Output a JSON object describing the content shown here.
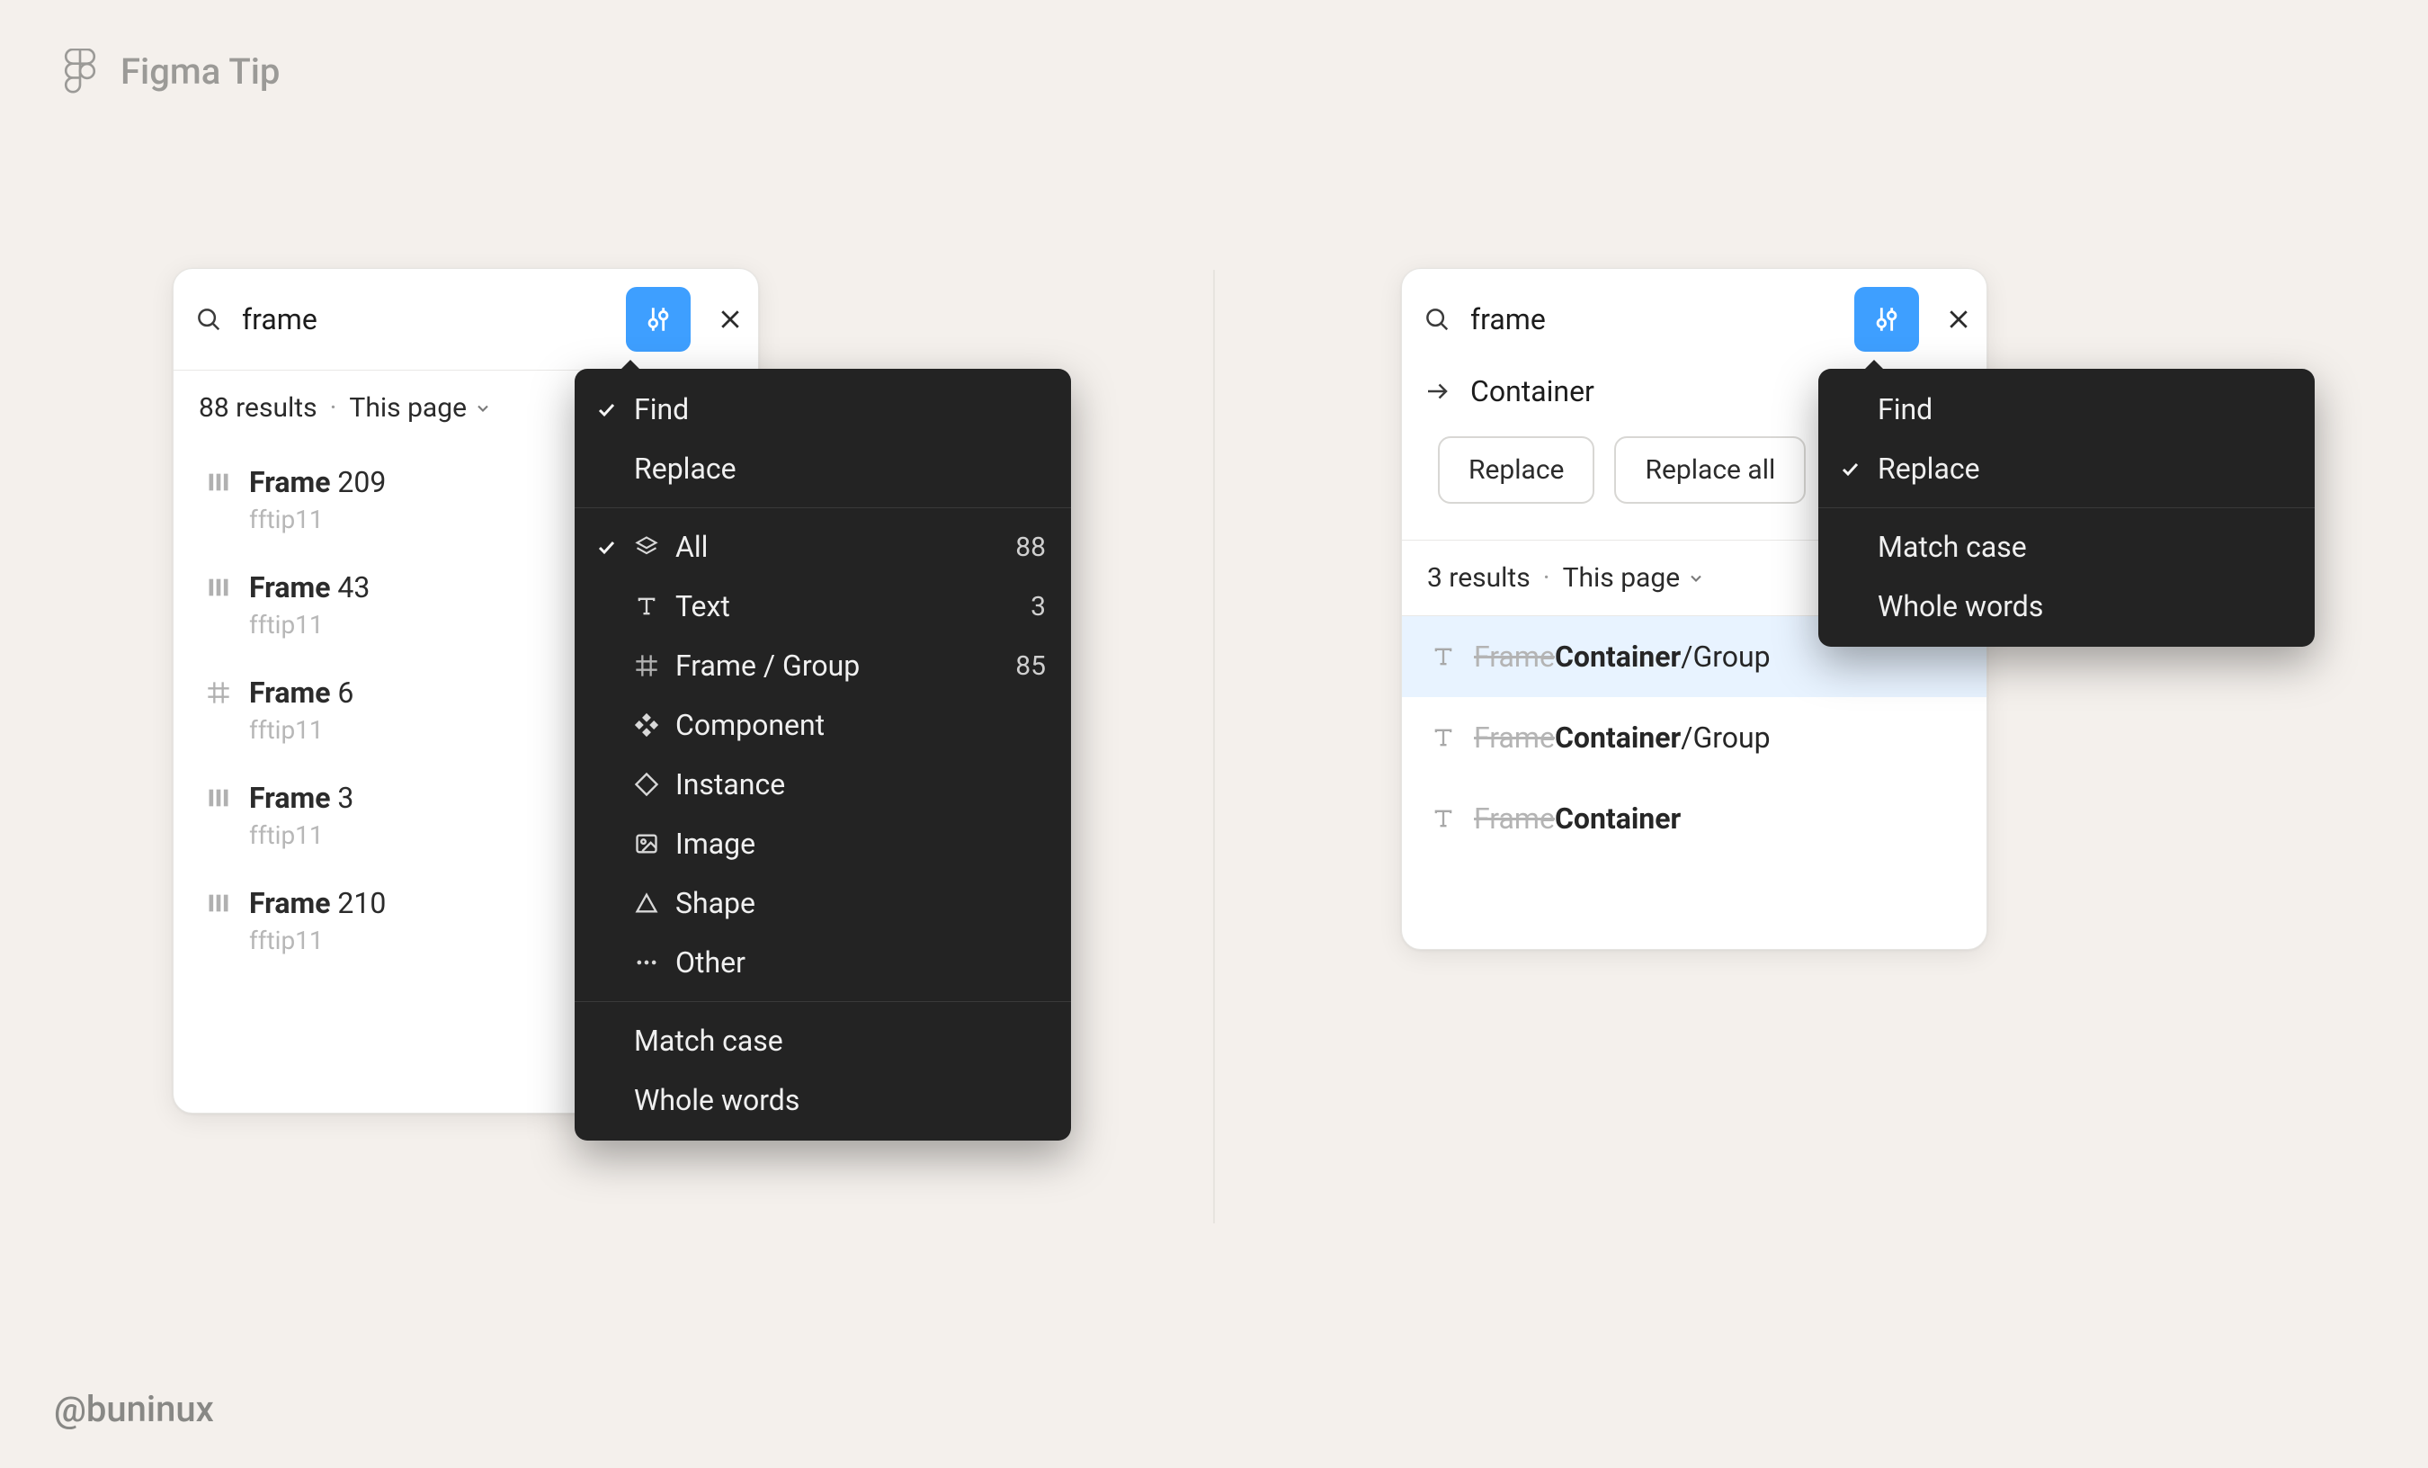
{
  "header": {
    "title": "Figma Tip"
  },
  "credit": "@buninux",
  "search_query": "frame",
  "left_panel": {
    "results_label": "88 results",
    "scope_label": "This page",
    "items": [
      {
        "icon": "autolayout",
        "bold": "Frame",
        "rest": " 209",
        "sub": "fftip11"
      },
      {
        "icon": "autolayout",
        "bold": "Frame",
        "rest": " 43",
        "sub": "fftip11"
      },
      {
        "icon": "frame",
        "bold": "Frame",
        "rest": " 6",
        "sub": "fftip11"
      },
      {
        "icon": "autolayout",
        "bold": "Frame",
        "rest": " 3",
        "sub": "fftip11"
      },
      {
        "icon": "autolayout",
        "bold": "Frame",
        "rest": " 210",
        "sub": "fftip11"
      }
    ]
  },
  "right_panel": {
    "replace_value": "Container",
    "replace_btn": "Replace",
    "replace_all_btn": "Replace all",
    "results_label": "3 results",
    "scope_label": "This page",
    "items": [
      {
        "highlight": true,
        "strike": "Frame",
        "bold": "Container",
        "rest": "/Group"
      },
      {
        "highlight": false,
        "strike": "Frame",
        "bold": "Container",
        "rest": "/Group"
      },
      {
        "highlight": false,
        "strike": "Frame",
        "bold": "Container",
        "rest": ""
      }
    ]
  },
  "menu_left": {
    "mode": {
      "find": "Find",
      "replace": "Replace",
      "checked": "find"
    },
    "filters": [
      {
        "icon": "all",
        "label": "All",
        "count": "88",
        "checked": true
      },
      {
        "icon": "text",
        "label": "Text",
        "count": "3"
      },
      {
        "icon": "frame",
        "label": "Frame / Group",
        "count": "85"
      },
      {
        "icon": "component",
        "label": "Component",
        "count": ""
      },
      {
        "icon": "instance",
        "label": "Instance",
        "count": ""
      },
      {
        "icon": "image",
        "label": "Image",
        "count": ""
      },
      {
        "icon": "shape",
        "label": "Shape",
        "count": ""
      },
      {
        "icon": "other",
        "label": "Other",
        "count": ""
      }
    ],
    "options": {
      "match_case": "Match case",
      "whole_words": "Whole words"
    }
  },
  "menu_right": {
    "mode": {
      "find": "Find",
      "replace": "Replace",
      "checked": "replace"
    },
    "options": {
      "match_case": "Match case",
      "whole_words": "Whole words"
    }
  }
}
